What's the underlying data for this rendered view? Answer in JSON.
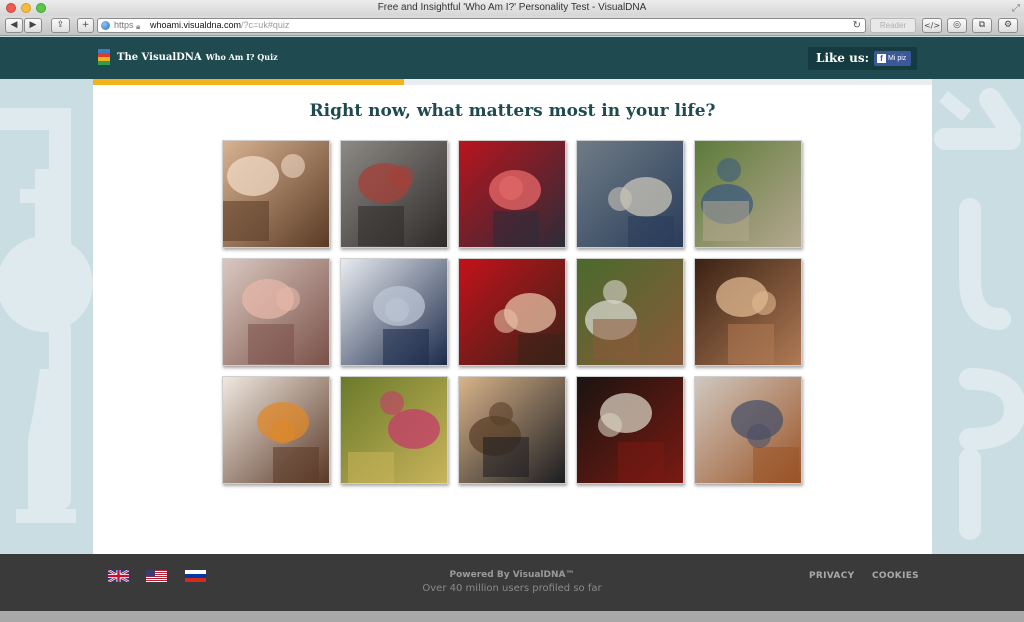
{
  "browser": {
    "window_title": "Free and Insightful 'Who Am I?' Personality Test - VisualDNA",
    "url_scheme": "https",
    "url_host": "whoami.visualdna.com",
    "url_path": "/?c=uk#quiz",
    "reader_label": "Reader",
    "code_label": "</>"
  },
  "header": {
    "brand": "The VisualDNA",
    "brand_sub": "Who Am I? Quiz",
    "like_label": "Like us:",
    "fb_label": "Mi piz",
    "logo_colors": [
      "#3a7fc3",
      "#e03a2a",
      "#f2b31b",
      "#2f9e4a"
    ]
  },
  "quiz": {
    "question": "Right now, what matters most in your life?",
    "progress_fraction": 0.371,
    "progress_color": "#f2b31b",
    "tiles": [
      {
        "name": "love-couple",
        "colors": [
          "#d8b392",
          "#5a3a24",
          "#f0d9c4"
        ]
      },
      {
        "name": "crowd-poverty",
        "colors": [
          "#8d8a86",
          "#2e2a28",
          "#a54038"
        ]
      },
      {
        "name": "red-car-washing",
        "colors": [
          "#b8141e",
          "#2c2c38",
          "#e86a6a"
        ]
      },
      {
        "name": "library-study",
        "colors": [
          "#6f7c86",
          "#2a3c5a",
          "#c9c5b8"
        ]
      },
      {
        "name": "meditation",
        "colors": [
          "#5d7b3a",
          "#b5a890",
          "#3c5a7e"
        ]
      },
      {
        "name": "money-banknotes",
        "colors": [
          "#d9c8c0",
          "#7a5048",
          "#e5b7a8"
        ]
      },
      {
        "name": "health-blood-pressure",
        "colors": [
          "#e8ecf0",
          "#1c2a4a",
          "#bcc6d4"
        ]
      },
      {
        "name": "happy-woman",
        "colors": [
          "#c3121a",
          "#3a2218",
          "#e7c0a5"
        ]
      },
      {
        "name": "home-garden-patio",
        "colors": [
          "#4a6a2c",
          "#8a5a3a",
          "#d8d8d0"
        ]
      },
      {
        "name": "party-crowd",
        "colors": [
          "#3a2214",
          "#b07a54",
          "#e0b890"
        ]
      },
      {
        "name": "makeup-beauty",
        "colors": [
          "#f0e8e0",
          "#5a3826",
          "#e08828"
        ]
      },
      {
        "name": "family-play",
        "colors": [
          "#6a7a2a",
          "#c9b45a",
          "#c43a6a"
        ]
      },
      {
        "name": "business-meeting",
        "colors": [
          "#d8b48a",
          "#1c1c20",
          "#5a4028"
        ]
      },
      {
        "name": "guitar-music",
        "colors": [
          "#1a1410",
          "#7a1a12",
          "#d8d0c0"
        ]
      },
      {
        "name": "dog-pet",
        "colors": [
          "#d0c8c0",
          "#9a5426",
          "#4a5068"
        ]
      }
    ]
  },
  "footer": {
    "powered": "Powered By VisualDNA™",
    "users": "Over 40 million users profiled so far",
    "privacy": "PRIVACY",
    "cookies": "COOKIES",
    "flags": [
      "uk-flag",
      "us-flag",
      "russia-flag"
    ]
  }
}
